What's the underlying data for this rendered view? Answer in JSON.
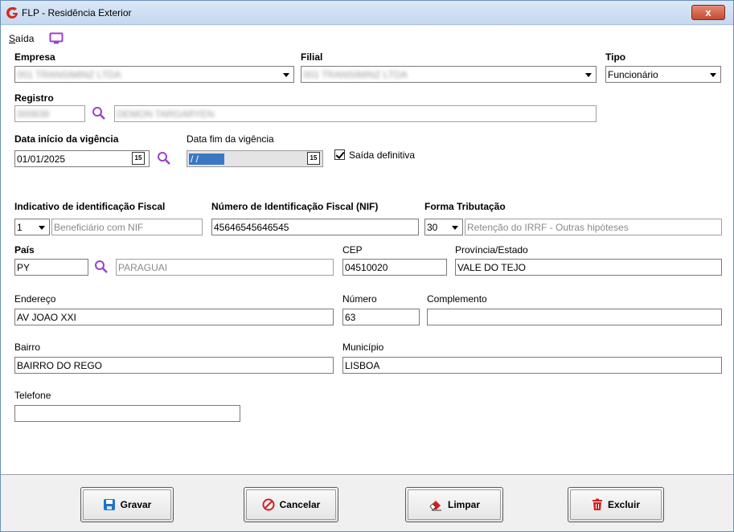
{
  "window": {
    "title": "FLP - Residência Exterior",
    "close_label": "x"
  },
  "menu": {
    "saida_prefix": "S",
    "saida_rest": "aída"
  },
  "form": {
    "empresa": {
      "label": "Empresa",
      "value": "001 TRANSIMINZ LTDA"
    },
    "filial": {
      "label": "Filial",
      "value": "001 TRANSIMINZ LTDA"
    },
    "tipo": {
      "label": "Tipo",
      "value": "Funcionário"
    },
    "registro": {
      "label": "Registro",
      "code": "000839",
      "name": "DEMON TARGARYEN"
    },
    "data_inicio": {
      "label": "Data início da vigência",
      "value": "01/01/2025",
      "cal_label": "15"
    },
    "data_fim": {
      "label": "Data fim da vigência",
      "value": " / /",
      "cal_label": "15"
    },
    "saida_definitiva": {
      "label": "Saída definitiva",
      "checked": true
    },
    "indicativo": {
      "label": "Indicativo de identificação Fiscal",
      "code": "1",
      "desc": "Beneficiário com NIF"
    },
    "nif": {
      "label": "Número de Identificação Fiscal (NIF)",
      "value": "45646545646545"
    },
    "forma_tributacao": {
      "label": "Forma Tributação",
      "code": "30",
      "desc": "Retenção do IRRF - Outras hipóteses"
    },
    "pais": {
      "label": "País",
      "code": "PY",
      "desc": "PARAGUAI"
    },
    "cep": {
      "label": "CEP",
      "value": "04510020"
    },
    "provincia": {
      "label": "Província/Estado",
      "value": "VALE DO TEJO"
    },
    "endereco": {
      "label": "Endereço",
      "value": "AV JOAO XXI"
    },
    "numero": {
      "label": "Número",
      "value": "63"
    },
    "complemento": {
      "label": "Complemento",
      "value": ""
    },
    "bairro": {
      "label": "Bairro",
      "value": "BAIRRO DO REGO"
    },
    "municipio": {
      "label": "Município",
      "value": "LISBOA"
    },
    "telefone": {
      "label": "Telefone",
      "value": ""
    }
  },
  "buttons": {
    "gravar": "Gravar",
    "cancelar": "Cancelar",
    "limpar": "Limpar",
    "excluir": "Excluir"
  },
  "colors": {
    "accent_purple": "#9b3fd0",
    "title_bg": "#c4d8ef",
    "close_red": "#c44b33",
    "save_blue": "#1e74c8",
    "cancel_red": "#d42020",
    "trash_red": "#d42020"
  }
}
